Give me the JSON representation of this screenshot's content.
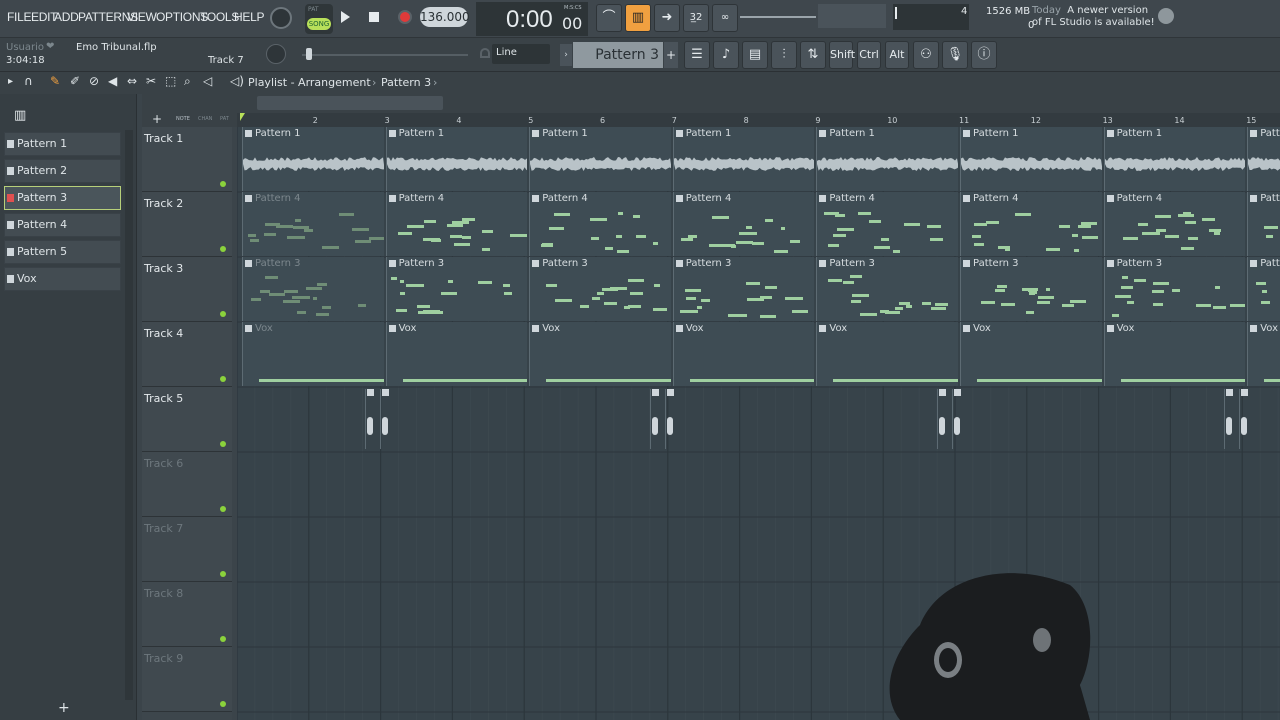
{
  "menu": [
    "FILE",
    "EDIT",
    "ADD",
    "PATTERNS",
    "VIEW",
    "OPTIONS",
    "TOOLS",
    "HELP"
  ],
  "transport": {
    "mode_top": "PAT",
    "mode": "SONG",
    "tempo": "136.000",
    "time": "0:00",
    "time_sub": "00",
    "time_label": "M:S:CS"
  },
  "meters": {
    "cpu_value": "4",
    "memory": "1526 MB",
    "voices": "0"
  },
  "news": {
    "date": "Today",
    "message": "A newer version of FL Studio is available!"
  },
  "hint": {
    "user": "Usuario",
    "project": "Emo Tribunal.flp",
    "time": "3:04:18",
    "track": "Track 7"
  },
  "snap": {
    "label": "Line"
  },
  "pattern_selector": {
    "current": "Pattern 3"
  },
  "mod_keys": [
    "Shift",
    "Ctrl",
    "Alt"
  ],
  "playlist": {
    "breadcrumb_1": "Playlist - Arrangement",
    "breadcrumb_2": "Pattern 3"
  },
  "picker_modes": [
    "NOTE",
    "CHAN",
    "PAT"
  ],
  "patterns": [
    "Pattern 1",
    "Pattern 2",
    "Pattern 3",
    "Pattern 4",
    "Pattern 5",
    "Vox"
  ],
  "selected_pattern": "Pattern 3",
  "tracks": [
    "Track 1",
    "Track 2",
    "Track 3",
    "Track 4",
    "Track 5",
    "Track 6",
    "Track 7",
    "Track 8",
    "Track 9"
  ],
  "ruler": [
    "2",
    "3",
    "4",
    "5",
    "6",
    "7",
    "8",
    "9",
    "10",
    "11",
    "12",
    "13",
    "14",
    "15"
  ],
  "clips": {
    "track1": "Pattern 1",
    "track2": "Pattern 4",
    "track3": "Pattern 3",
    "track4": "Vox",
    "track4_ghost": "Vox",
    "track2_ghost": "Pattern 4",
    "track3_ghost": "Pattern 3"
  },
  "colors": {
    "accent": "#f0a040",
    "song_green": "#b8e05a",
    "track_dot": "#8bd23c",
    "note_green": "#9fcfa0"
  }
}
